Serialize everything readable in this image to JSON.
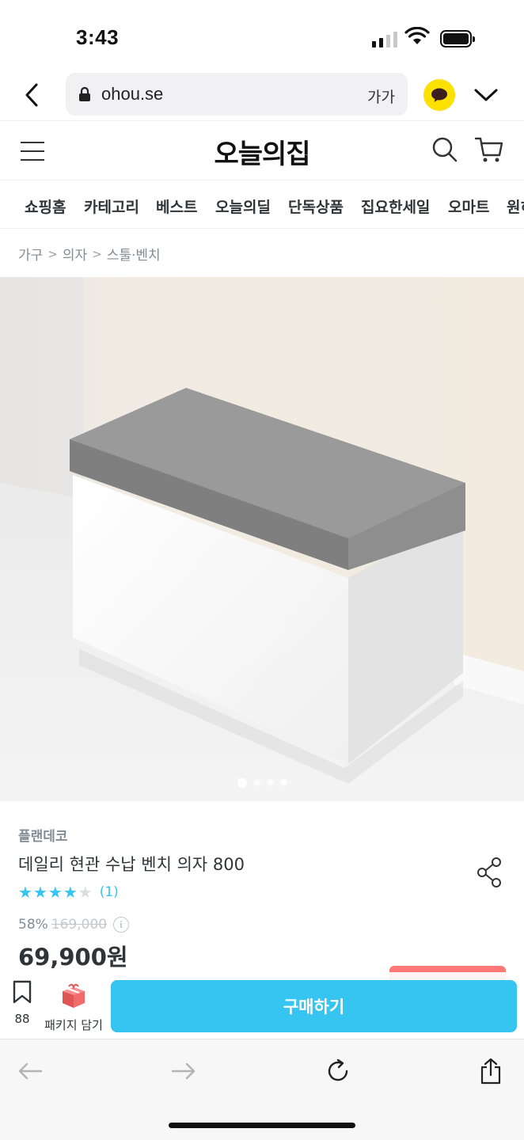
{
  "status_bar": {
    "time": "3:43"
  },
  "browser": {
    "url": "ohou.se",
    "font_size_label": "가가"
  },
  "site": {
    "logo": "오늘의집"
  },
  "categories": [
    "쇼핑홈",
    "카테고리",
    "베스트",
    "오늘의딜",
    "단독상품",
    "집요한세일",
    "오마트",
    "원히"
  ],
  "breadcrumb": [
    "가구",
    "의자",
    "스툴·벤치"
  ],
  "gallery": {
    "total": 4,
    "active": 1
  },
  "product": {
    "brand": "플랜데코",
    "title": "데일리 현관 수납 벤치 의자 800",
    "rating": 4,
    "rating_max": 5,
    "review_count": "(1)",
    "discount_rate": "58%",
    "original_price": "169,000",
    "price": "69,900원"
  },
  "action_bar": {
    "scrap_count": "88",
    "package_label": "패키지 담기",
    "buy_label": "구매하기"
  },
  "colors": {
    "accent": "#35c5f0",
    "star": "#35c5f0",
    "kakao": "#fae100",
    "text": "#2f3438",
    "muted": "#828c94"
  }
}
